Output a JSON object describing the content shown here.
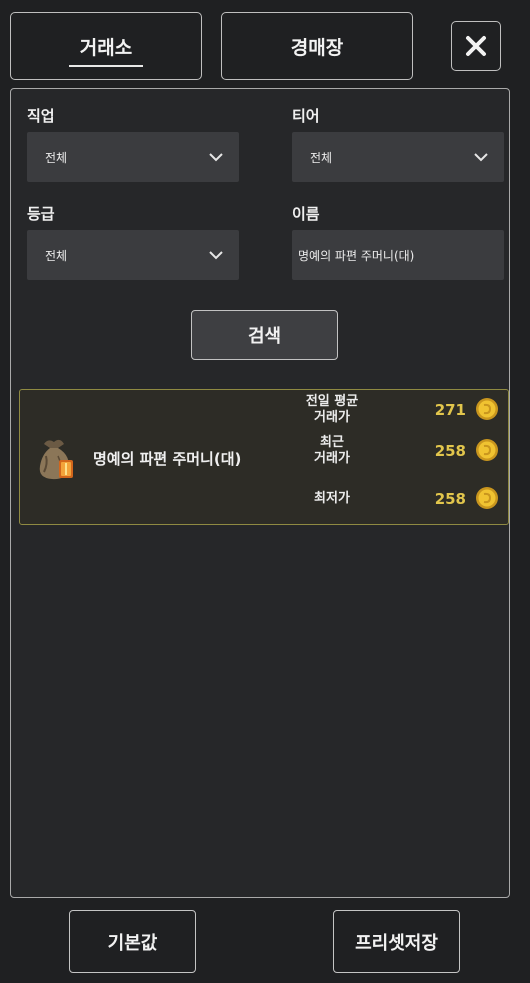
{
  "tabs": {
    "trade": "거래소",
    "auction": "경매장"
  },
  "close_icon": "close-icon",
  "filters": {
    "job": {
      "label": "직업",
      "value": "전체"
    },
    "tier": {
      "label": "티어",
      "value": "전체"
    },
    "grade": {
      "label": "등급",
      "value": "전체"
    },
    "name": {
      "label": "이름",
      "value": "명예의 파편 주머니(대)"
    }
  },
  "search_button": "검색",
  "result": {
    "item_name": "명예의 파편 주머니(대)",
    "item_icon": "pouch-icon",
    "prices": [
      {
        "label_line1": "전일 평균",
        "label_line2": "거래가",
        "value": "271"
      },
      {
        "label_line1": "최근",
        "label_line2": "거래가",
        "value": "258"
      },
      {
        "label_line1": "최저가",
        "label_line2": "",
        "value": "258"
      }
    ],
    "currency_icon": "gold-coin-icon"
  },
  "footer": {
    "default_button": "기본값",
    "save_preset_button": "프리셋저장"
  },
  "colors": {
    "background": "#1f2022",
    "panel": "#262729",
    "field": "#3b3c3f",
    "card_border": "#8f8a42",
    "price_gold": "#e2c64c"
  }
}
